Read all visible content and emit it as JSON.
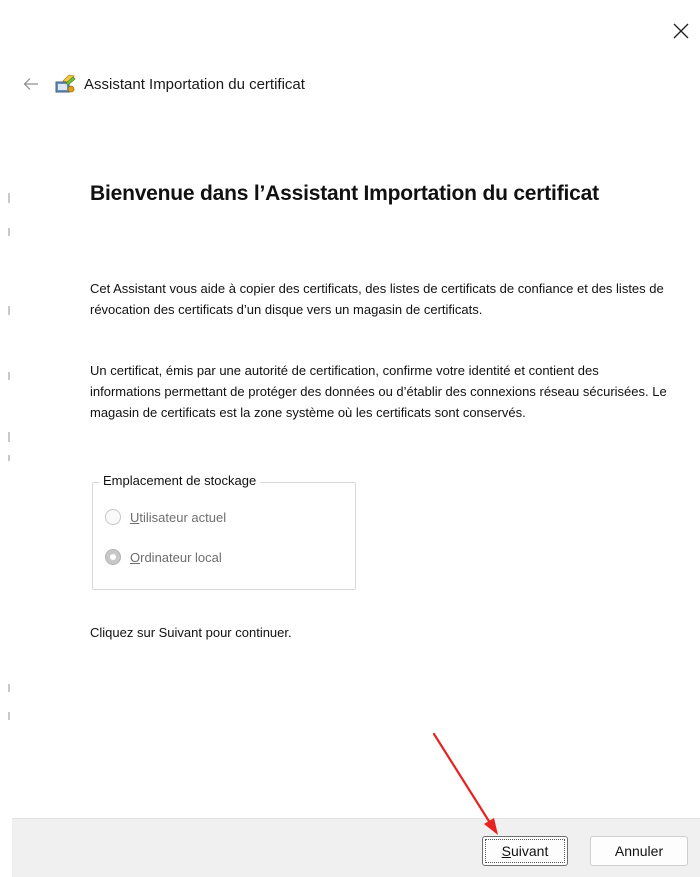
{
  "window": {
    "close_glyph": "X",
    "back_icon": "back-arrow-icon",
    "wizard_icon": "certificate-wizard-icon",
    "header_title": "Assistant Importation du certificat"
  },
  "main": {
    "title": "Bienvenue dans l’Assistant Importation du certificat",
    "paragraph1": "Cet Assistant vous aide à copier des certificats, des listes de certificats de confiance et des listes de révocation des certificats d’un disque vers un magasin de certificats.",
    "paragraph2": "Un certificat, émis par une autorité de certification, confirme votre identité et contient des informations permettant de protéger des données ou d’établir des connexions réseau sécurisées. Le magasin de certificats est la zone système où les certificats sont conservés.",
    "storage": {
      "legend": "Emplacement de stockage",
      "options": [
        {
          "accel": "U",
          "rest": "tilisateur actuel",
          "selected": false,
          "enabled": false
        },
        {
          "accel": "O",
          "rest": "rdinateur local",
          "selected": true,
          "enabled": false
        }
      ]
    },
    "paragraph3": "Cliquez sur Suivant pour continuer."
  },
  "footer": {
    "next": {
      "accel": "S",
      "rest": "uivant"
    },
    "cancel": "Annuler"
  },
  "annotation": {
    "type": "arrow",
    "color": "#e52320",
    "points_to": "next-button"
  },
  "colors": {
    "footer_bg": "#f0f0f0",
    "disabled_text": "#6e6e6e"
  }
}
